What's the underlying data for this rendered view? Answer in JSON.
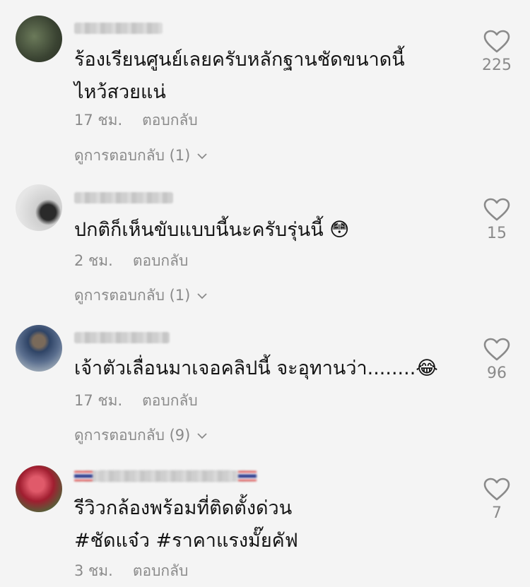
{
  "comments": [
    {
      "text": "ร้องเรียนศูนย์เลยครับหลักฐานชัดขนาดนี้\nไหว้สวยแน่",
      "time": "17 ชม.",
      "reply_label": "ตอบกลับ",
      "view_replies": "ดูการตอบกลับ (1)",
      "likes": "225",
      "avatar_color": "#4a5a3e"
    },
    {
      "text": "ปกติก็เห็นขับแบบนี้นะครับรุ่นนี้ 😳",
      "time": "2 ชม.",
      "reply_label": "ตอบกลับ",
      "view_replies": "ดูการตอบกลับ (1)",
      "likes": "15",
      "avatar_color": "#d9d9d9"
    },
    {
      "text": "เจ้าตัวเลื่อนมาเจอคลิปนี้ จะอุทานว่า........😂",
      "time": "17 ชม.",
      "reply_label": "ตอบกลับ",
      "view_replies": "ดูการตอบกลับ (9)",
      "likes": "96",
      "avatar_color": "#3c4e6a"
    },
    {
      "text": "รีวิวกล้องพร้อมที่ติดตั้งด่วน\n#ชัดแจ๋ว #ราคาแรงมั๊ยคัฟ",
      "time": "3 ชม.",
      "reply_label": "ตอบกลับ",
      "likes": "7",
      "avatar_color": "#b8283a"
    }
  ],
  "icons": {
    "like": "heart-outline-icon",
    "expand": "chevron-down-icon"
  }
}
